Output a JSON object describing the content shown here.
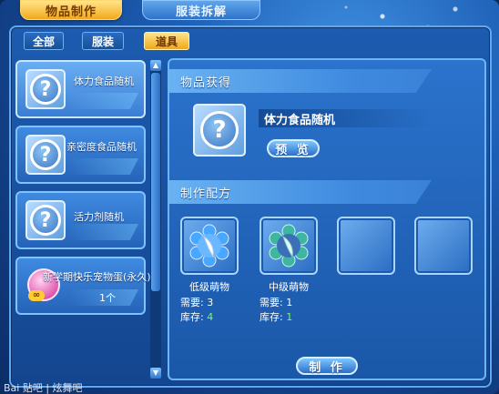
{
  "top_tabs": [
    {
      "label": "物品制作",
      "active": true
    },
    {
      "label": "服装拆解",
      "active": false
    }
  ],
  "filters": [
    {
      "label": "全部",
      "active": false
    },
    {
      "label": "服装",
      "active": false
    },
    {
      "label": "道具",
      "active": true
    }
  ],
  "items": [
    {
      "name": "体力食品随机",
      "icon": "question-mark-icon",
      "selected": true
    },
    {
      "name": "亲密度食品随机",
      "icon": "question-mark-icon",
      "selected": false
    },
    {
      "name": "活力剂随机",
      "icon": "question-mark-icon",
      "selected": false
    },
    {
      "name": "新学期快乐宠物蛋(永久)",
      "icon": "pet-egg-icon",
      "badge": "∞",
      "count": "1个",
      "selected": false
    }
  ],
  "result": {
    "section_title": "物品获得",
    "name": "体力食品随机",
    "icon": "question-mark-icon",
    "preview_label": "预 览"
  },
  "recipe": {
    "section_title": "制作配方",
    "materials": [
      {
        "name": "低级萌物",
        "icon": "blue-flower-feather-icon",
        "need_label": "需要:",
        "need": "3",
        "stock_label": "库存:",
        "stock": "4"
      },
      {
        "name": "中级萌物",
        "icon": "green-flower-feather-icon",
        "need_label": "需要:",
        "need": "1",
        "stock_label": "库存:",
        "stock": "1"
      }
    ],
    "craft_label": "制 作"
  },
  "watermark": "Bai 贴吧 | 炫舞吧",
  "colors": {
    "active_tab": "#f2a81c",
    "panel": "#1c5bb0",
    "stock_ok": "#7dff4a"
  }
}
